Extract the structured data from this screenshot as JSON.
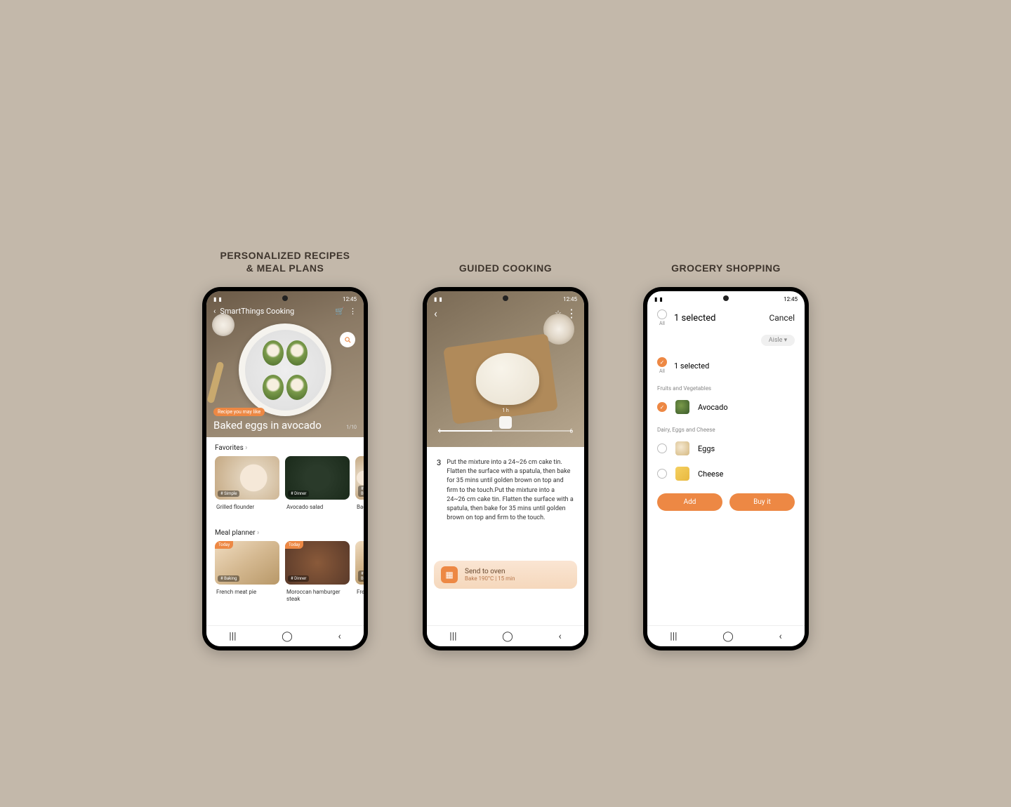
{
  "columns": {
    "recipes_title": "PERSONALIZED RECIPES\n& MEAL PLANS",
    "cooking_title": "GUIDED COOKING",
    "shopping_title": "GROCERY SHOPPING"
  },
  "status": {
    "time": "12:45"
  },
  "phone1": {
    "app_title": "SmartThings Cooking",
    "recipe_badge": "Recipe you may like",
    "recipe_title": "Baked eggs in avocado",
    "pager": "1/10",
    "favorites_head": "Favorites",
    "favorites": [
      {
        "tag": "# Simple",
        "label": "Grilled flounder"
      },
      {
        "tag": "# Dinner",
        "label": "Avocado salad"
      },
      {
        "tag": "# B",
        "label": "Bac"
      }
    ],
    "meal_head": "Meal planner",
    "meals": [
      {
        "today": "Today",
        "tag": "# Baking",
        "label": "French meat pie"
      },
      {
        "today": "Today",
        "tag": "# Dinner",
        "label": "Moroccan hamburger steak"
      },
      {
        "tag": "# B",
        "label": "Fren"
      }
    ]
  },
  "phone2": {
    "timeline": {
      "start": "1",
      "end": "6",
      "step_time": "1 h"
    },
    "step_num": "3",
    "step_text": "Put the mixture into a 24~26 cm cake tin. Flatten the surface with a spatula, then bake for 35 mins until golden brown on top and firm to the touch.Put the mixture into a 24~26 cm cake tin. Flatten the surface with a spatula, then bake for 35 mins until golden brown on top and firm to the touch.",
    "oven": {
      "title": "Send to oven",
      "sub": "Bake 190°C | 15 min"
    }
  },
  "phone3": {
    "head_all": "All",
    "head_selected": "1 selected",
    "cancel": "Cancel",
    "aisle": "Aisle ▾",
    "section_all": "All",
    "section_selected": "1 selected",
    "cat1": "Fruits and Vegetables",
    "item_avocado": "Avocado",
    "cat2": "Dairy, Eggs and Cheese",
    "item_eggs": "Eggs",
    "item_cheese": "Cheese",
    "btn_add": "Add",
    "btn_buy": "Buy it"
  }
}
